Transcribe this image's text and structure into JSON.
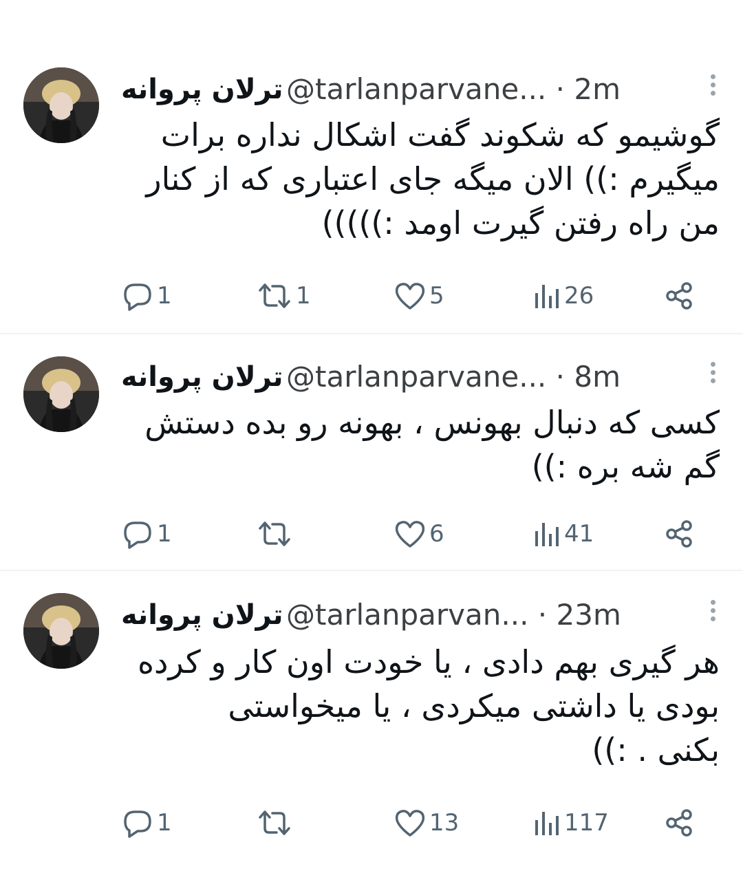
{
  "tweets": [
    {
      "name": "ترلان پروانه",
      "handle": "@tarlanparvane...",
      "time": "· 2m",
      "lines": [
        "گوشیمو که شکوند گفت اشکال نداره برات",
        "میگیرم :)) الان میگه جای اعتباری که از کنار",
        "من راه رفتن گیرت اومد :)))))"
      ],
      "replies": "1",
      "retweets": "1",
      "likes": "5",
      "views": "26"
    },
    {
      "name": "ترلان پروانه",
      "handle": "@tarlanparvane...",
      "time": "· 8m",
      "lines": [
        "کسی که دنبال بهونس ، بهونه رو بده دستش",
        "گم شه بره :))"
      ],
      "replies": "1",
      "retweets": "",
      "likes": "6",
      "views": "41"
    },
    {
      "name": "ترلان پروانه",
      "handle": "@tarlanparvan...",
      "time": "· 23m",
      "lines": [
        "هر گیری بهم دادی ، یا خودت اون کار و کرده",
        "بودی یا داشتی میکردی ، یا میخواستی",
        "بکنی . :))"
      ],
      "replies": "1",
      "retweets": "",
      "likes": "13",
      "views": "117"
    }
  ],
  "icons": {
    "reply": "reply-icon",
    "retweet": "retweet-icon",
    "like": "heart-icon",
    "views": "views-icon",
    "share": "share-icon",
    "more": "more-vertical-icon"
  },
  "colors": {
    "icon": "#536471",
    "text": "#0f1419",
    "handle": "#3c4043",
    "divider": "#eff3f4"
  }
}
